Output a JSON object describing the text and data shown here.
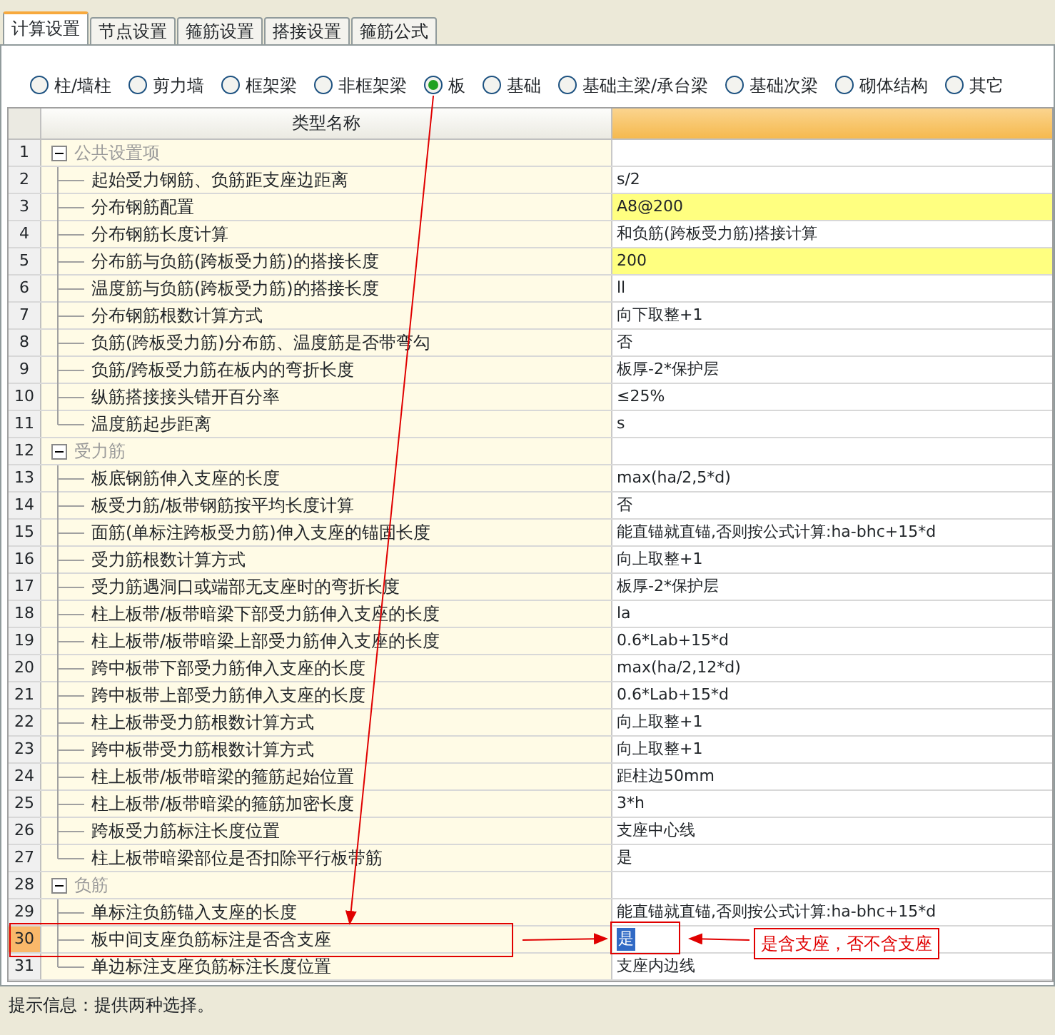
{
  "tabs": [
    {
      "label": "计算设置",
      "selected": true
    },
    {
      "label": "节点设置",
      "selected": false
    },
    {
      "label": "箍筋设置",
      "selected": false
    },
    {
      "label": "搭接设置",
      "selected": false
    },
    {
      "label": "箍筋公式",
      "selected": false
    }
  ],
  "categories": [
    {
      "label": "柱/墙柱",
      "selected": false
    },
    {
      "label": "剪力墙",
      "selected": false
    },
    {
      "label": "框架梁",
      "selected": false
    },
    {
      "label": "非框架梁",
      "selected": false
    },
    {
      "label": "板",
      "selected": true
    },
    {
      "label": "基础",
      "selected": false
    },
    {
      "label": "基础主梁/承台梁",
      "selected": false
    },
    {
      "label": "基础次梁",
      "selected": false
    },
    {
      "label": "砌体结构",
      "selected": false
    },
    {
      "label": "其它",
      "selected": false
    }
  ],
  "table": {
    "columns": [
      "类型名称"
    ],
    "groups": [
      {
        "number": "1",
        "name": "公共设置项",
        "expanded": true,
        "children": [
          {
            "number": "2",
            "name": "起始受力钢筋、负筋距支座边距离",
            "value": "s/2",
            "highlighted": false,
            "selected": false
          },
          {
            "number": "3",
            "name": "分布钢筋配置",
            "value": "A8@200",
            "highlighted": true,
            "selected": false
          },
          {
            "number": "4",
            "name": "分布钢筋长度计算",
            "value": "和负筋(跨板受力筋)搭接计算",
            "highlighted": false,
            "selected": false
          },
          {
            "number": "5",
            "name": "分布筋与负筋(跨板受力筋)的搭接长度",
            "value": "200",
            "highlighted": true,
            "selected": false
          },
          {
            "number": "6",
            "name": "温度筋与负筋(跨板受力筋)的搭接长度",
            "value": "ll",
            "highlighted": false,
            "selected": false
          },
          {
            "number": "7",
            "name": "分布钢筋根数计算方式",
            "value": "向下取整+1",
            "highlighted": false,
            "selected": false
          },
          {
            "number": "8",
            "name": "负筋(跨板受力筋)分布筋、温度筋是否带弯勾",
            "value": "否",
            "highlighted": false,
            "selected": false
          },
          {
            "number": "9",
            "name": "负筋/跨板受力筋在板内的弯折长度",
            "value": "板厚-2*保护层",
            "highlighted": false,
            "selected": false
          },
          {
            "number": "10",
            "name": "纵筋搭接接头错开百分率",
            "value": "≤25%",
            "highlighted": false,
            "selected": false
          },
          {
            "number": "11",
            "name": "温度筋起步距离",
            "value": "s",
            "highlighted": false,
            "selected": false
          }
        ]
      },
      {
        "number": "12",
        "name": "受力筋",
        "expanded": true,
        "children": [
          {
            "number": "13",
            "name": "板底钢筋伸入支座的长度",
            "value": "max(ha/2,5*d)",
            "highlighted": false,
            "selected": false
          },
          {
            "number": "14",
            "name": "板受力筋/板带钢筋按平均长度计算",
            "value": "否",
            "highlighted": false,
            "selected": false
          },
          {
            "number": "15",
            "name": "面筋(单标注跨板受力筋)伸入支座的锚固长度",
            "value": "能直锚就直锚,否则按公式计算:ha-bhc+15*d",
            "highlighted": false,
            "selected": false
          },
          {
            "number": "16",
            "name": "受力筋根数计算方式",
            "value": "向上取整+1",
            "highlighted": false,
            "selected": false
          },
          {
            "number": "17",
            "name": "受力筋遇洞口或端部无支座时的弯折长度",
            "value": "板厚-2*保护层",
            "highlighted": false,
            "selected": false
          },
          {
            "number": "18",
            "name": "柱上板带/板带暗梁下部受力筋伸入支座的长度",
            "value": "la",
            "highlighted": false,
            "selected": false
          },
          {
            "number": "19",
            "name": "柱上板带/板带暗梁上部受力筋伸入支座的长度",
            "value": "0.6*Lab+15*d",
            "highlighted": false,
            "selected": false
          },
          {
            "number": "20",
            "name": "跨中板带下部受力筋伸入支座的长度",
            "value": "max(ha/2,12*d)",
            "highlighted": false,
            "selected": false
          },
          {
            "number": "21",
            "name": "跨中板带上部受力筋伸入支座的长度",
            "value": "0.6*Lab+15*d",
            "highlighted": false,
            "selected": false
          },
          {
            "number": "22",
            "name": "柱上板带受力筋根数计算方式",
            "value": "向上取整+1",
            "highlighted": false,
            "selected": false
          },
          {
            "number": "23",
            "name": "跨中板带受力筋根数计算方式",
            "value": "向上取整+1",
            "highlighted": false,
            "selected": false
          },
          {
            "number": "24",
            "name": "柱上板带/板带暗梁的箍筋起始位置",
            "value": "距柱边50mm",
            "highlighted": false,
            "selected": false
          },
          {
            "number": "25",
            "name": "柱上板带/板带暗梁的箍筋加密长度",
            "value": "3*h",
            "highlighted": false,
            "selected": false
          },
          {
            "number": "26",
            "name": "跨板受力筋标注长度位置",
            "value": "支座中心线",
            "highlighted": false,
            "selected": false
          },
          {
            "number": "27",
            "name": "柱上板带暗梁部位是否扣除平行板带筋",
            "value": "是",
            "highlighted": false,
            "selected": false
          }
        ]
      },
      {
        "number": "28",
        "name": "负筋",
        "expanded": true,
        "children": [
          {
            "number": "29",
            "name": "单标注负筋锚入支座的长度",
            "value": "能直锚就直锚,否则按公式计算:ha-bhc+15*d",
            "highlighted": false,
            "selected": false
          },
          {
            "number": "30",
            "name": "板中间支座负筋标注是否含支座",
            "value": "是",
            "highlighted": false,
            "selected": true
          },
          {
            "number": "31",
            "name": "单边标注支座负筋标注长度位置",
            "value": "支座内边线",
            "highlighted": false,
            "selected": false
          }
        ]
      }
    ]
  },
  "annotation": {
    "text": "是含支座，否不含支座"
  },
  "status_bar": "提示信息：提供两种选择。"
}
